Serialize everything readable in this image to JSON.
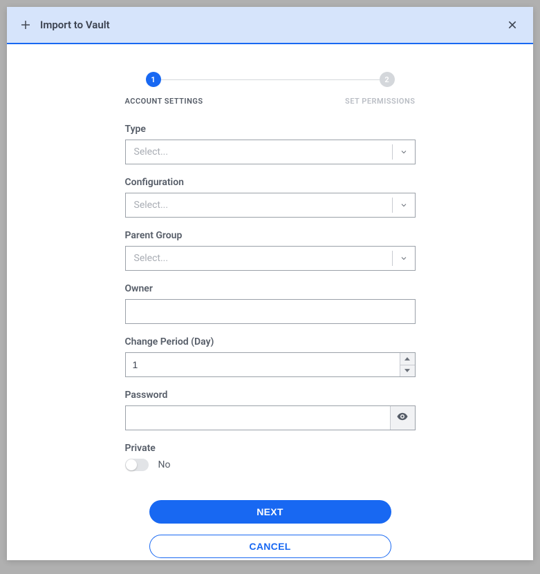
{
  "header": {
    "title": "Import to Vault"
  },
  "stepper": {
    "step1_num": "1",
    "step2_num": "2",
    "step1_label": "ACCOUNT SETTINGS",
    "step2_label": "SET PERMISSIONS"
  },
  "form": {
    "type": {
      "label": "Type",
      "placeholder": "Select..."
    },
    "configuration": {
      "label": "Configuration",
      "placeholder": "Select..."
    },
    "parent_group": {
      "label": "Parent Group",
      "placeholder": "Select..."
    },
    "owner": {
      "label": "Owner",
      "value": ""
    },
    "change_period": {
      "label": "Change Period (Day)",
      "value": "1"
    },
    "password": {
      "label": "Password",
      "value": ""
    },
    "private": {
      "label": "Private",
      "value_text": "No"
    }
  },
  "buttons": {
    "next": "NEXT",
    "cancel": "CANCEL"
  }
}
